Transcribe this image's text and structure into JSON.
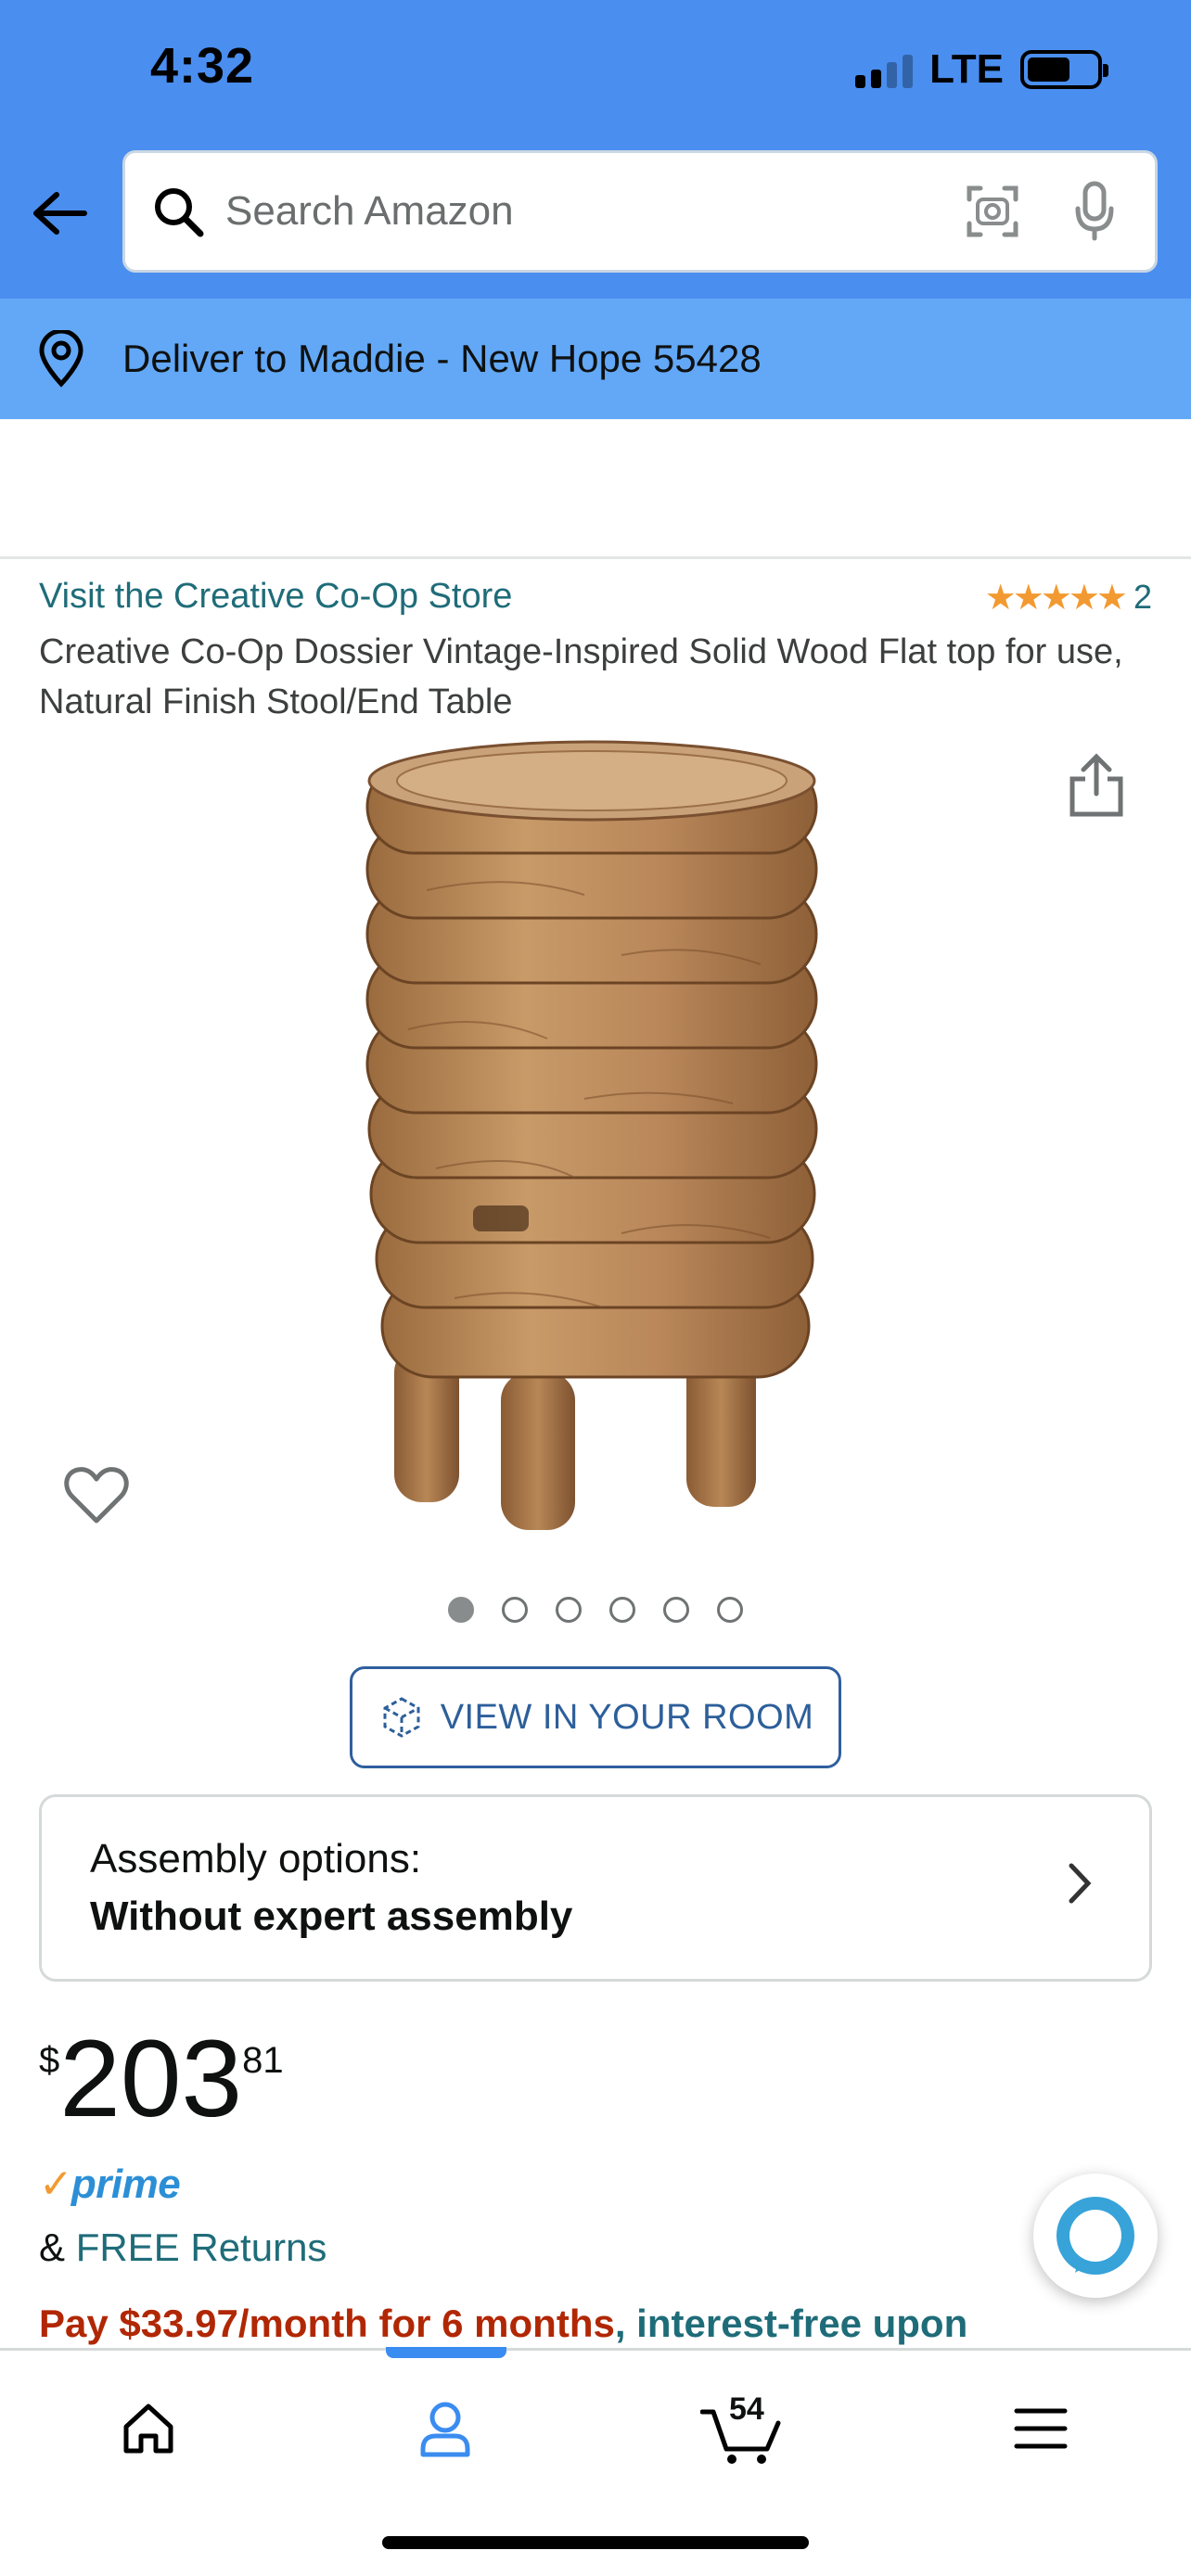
{
  "status_bar": {
    "time": "4:32",
    "network": "LTE"
  },
  "search": {
    "placeholder": "Search Amazon"
  },
  "delivery": {
    "text": "Deliver to Maddie - New Hope 55428"
  },
  "product": {
    "store_link": "Visit the Creative Co-Op Store",
    "rating_stars": "★★★★★",
    "rating_value": 5,
    "rating_count": "2",
    "title": "Creative Co-Op Dossier Vintage-Inspired Solid Wood Flat top for use, Natural Finish Stool/End Table",
    "image_count": 6,
    "active_image": 0
  },
  "view_in_room": {
    "label": "VIEW IN YOUR ROOM"
  },
  "assembly": {
    "label": "Assembly options:",
    "value": "Without expert assembly"
  },
  "price": {
    "symbol": "$",
    "whole": "203",
    "fraction": "81"
  },
  "prime": {
    "check": "✓",
    "text": "prime"
  },
  "returns": {
    "prefix": "& ",
    "link": "FREE Returns"
  },
  "financing": {
    "pay": "Pay ",
    "amount": "$33.97/month for 6 months",
    "suffix": ", interest-free upon"
  },
  "tabbar": {
    "cart_count": "54",
    "active_tab": "account"
  },
  "icons": {
    "back": "back-arrow-icon",
    "search": "search-icon",
    "camera": "camera-scan-icon",
    "mic": "microphone-icon",
    "location": "location-pin-icon",
    "share": "share-icon",
    "wishlist": "heart-icon",
    "ar": "ar-cube-icon",
    "chevron": "chevron-right-icon",
    "alexa": "alexa-icon",
    "home": "home-icon",
    "account": "account-icon",
    "cart": "cart-icon",
    "menu": "hamburger-menu-icon"
  },
  "colors": {
    "header_bg": "#4a8ef0",
    "delivery_bg": "#62a8f7",
    "link": "#1f6c79",
    "price_red": "#b12704",
    "star": "#f29a31",
    "prime_blue": "#2c8fd6",
    "active_tab": "#3a8cf0"
  }
}
